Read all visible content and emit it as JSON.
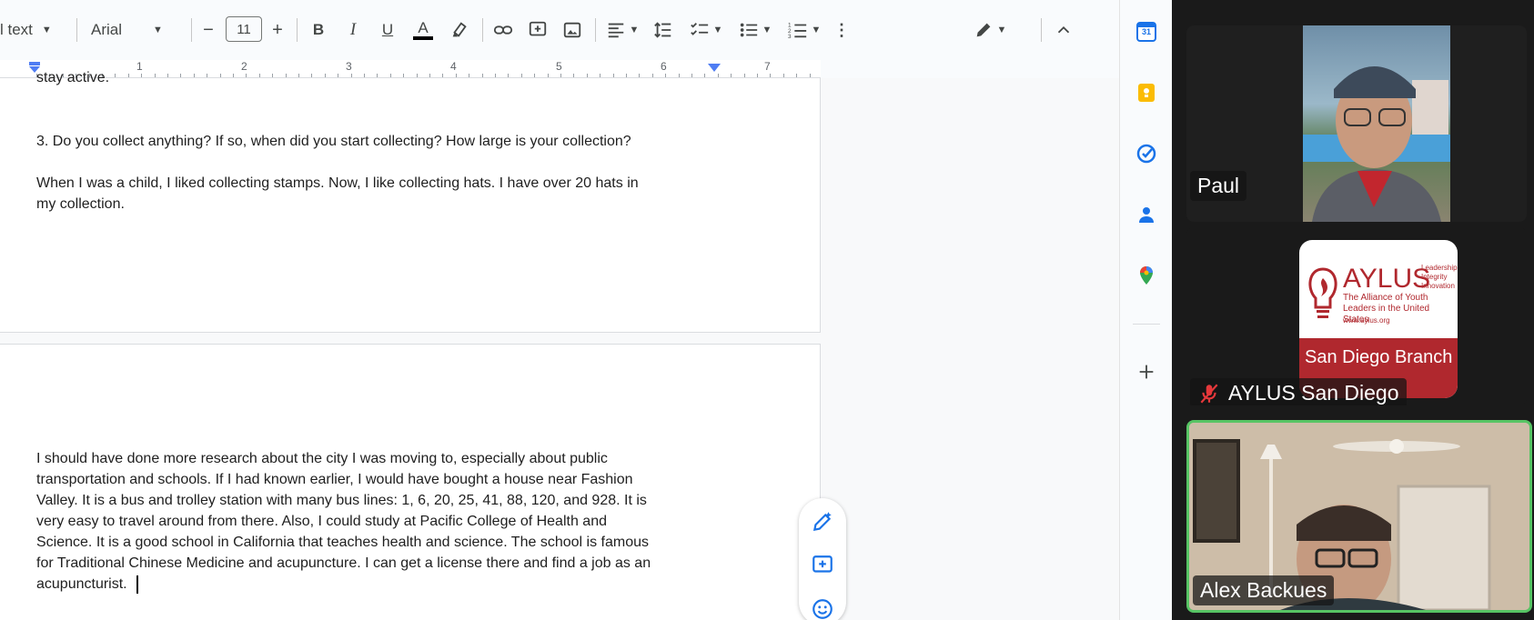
{
  "toolbar": {
    "style_label": "l text",
    "font_name": "Arial",
    "font_size": "11",
    "minus": "−",
    "plus": "+",
    "bold": "B",
    "italic": "I",
    "underline": "U",
    "text_color": "A"
  },
  "ruler": {
    "numbers": [
      "1",
      "2",
      "3",
      "4",
      "5",
      "6",
      "7"
    ]
  },
  "document": {
    "cut_line": "stay active.",
    "question": "3. Do you collect anything? If so, when did you start collecting? How large is your collection?",
    "answer_line1": "When I was a child, I liked collecting stamps. Now, I like collecting hats. I have over 20 hats in",
    "answer_line2": "my collection.",
    "p2_lines": [
      "I should have done more research about the city I was moving to, especially about public",
      "transportation and schools. If I had known earlier, I would have bought a house near Fashion",
      "Valley. It is a bus and trolley station with many bus lines: 1, 6, 20, 25, 41, 88, 120, and 928. It is",
      "very easy to travel around from there. Also, I could study at Pacific College of Health and",
      "Science. It is a good school in California that teaches health and science. The school is famous",
      "for Traditional Chinese Medicine and acupuncture. I can get a license there and find a job as an",
      "acupuncturist."
    ]
  },
  "side_panel": {
    "calendar_day": "31",
    "icons": [
      "calendar-icon",
      "keep-icon",
      "tasks-icon",
      "contacts-icon",
      "maps-icon",
      "add-icon"
    ]
  },
  "float_tools": [
    "edit-suggest-icon",
    "add-comment-icon",
    "emoji-icon"
  ],
  "participants": {
    "paul": {
      "name": "Paul"
    },
    "aylus": {
      "name": "AYLUS San Diego",
      "logo_brand": "AYLUS",
      "logo_tagline": [
        "Leadership",
        "Integrity",
        "Innovation"
      ],
      "logo_org": "The Alliance of Youth Leaders in the United States",
      "logo_url": "www.aylus.org",
      "logo_branch": "San Diego Branch"
    },
    "alex": {
      "name": "Alex Backues"
    }
  },
  "colors": {
    "accent": "#1a73e8",
    "aylus_red": "#b0282e",
    "speaker_border": "#57c464",
    "muted_red": "#e5383b"
  }
}
